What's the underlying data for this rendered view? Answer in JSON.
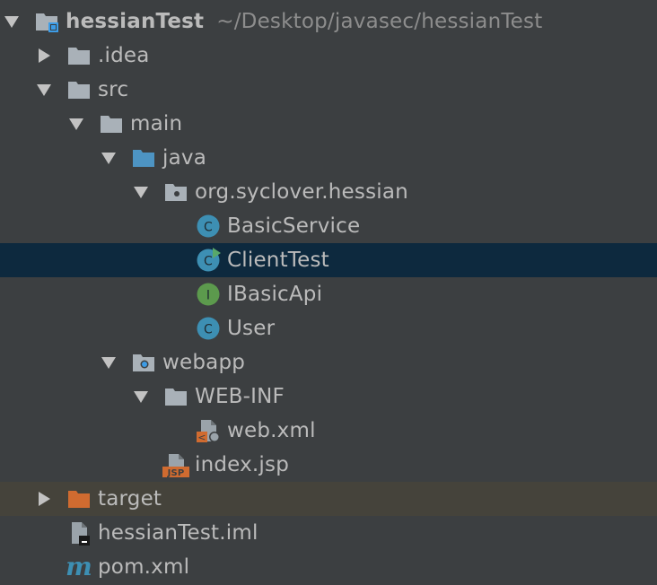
{
  "colors": {
    "background": "#3c3f41",
    "selected_row": "#0d293e",
    "excluded_row": "#45433b",
    "text": "#bbbbbb",
    "path_text": "#8d8d8d",
    "folder": "#a9b1b8",
    "source_folder": "#4d94c3",
    "class_icon": "#3d8fb3",
    "interface_icon": "#5c9a4d",
    "excluded_folder": "#d06b30"
  },
  "tree": [
    {
      "label": "hessianTest",
      "path": "~/Desktop/javasec/hessianTest",
      "icon": "module-folder-icon",
      "arrow": "expanded"
    },
    {
      "label": ".idea",
      "icon": "folder-icon",
      "arrow": "collapsed"
    },
    {
      "label": "src",
      "icon": "folder-icon",
      "arrow": "expanded"
    },
    {
      "label": "main",
      "icon": "folder-icon",
      "arrow": "expanded"
    },
    {
      "label": "java",
      "icon": "source-folder-icon",
      "arrow": "expanded"
    },
    {
      "label": "org.syclover.hessian",
      "icon": "package-icon",
      "arrow": "expanded"
    },
    {
      "label": "BasicService",
      "icon": "class-icon",
      "glyph": "C",
      "arrow": "none"
    },
    {
      "label": "ClientTest",
      "icon": "runnable-class-icon",
      "glyph": "C",
      "arrow": "none",
      "selected": true
    },
    {
      "label": "IBasicApi",
      "icon": "interface-icon",
      "glyph": "I",
      "arrow": "none"
    },
    {
      "label": "User",
      "icon": "class-icon",
      "glyph": "C",
      "arrow": "none"
    },
    {
      "label": "webapp",
      "icon": "web-folder-icon",
      "arrow": "expanded"
    },
    {
      "label": "WEB-INF",
      "icon": "folder-icon",
      "arrow": "expanded"
    },
    {
      "label": "web.xml",
      "icon": "web-xml-icon",
      "arrow": "none"
    },
    {
      "label": "index.jsp",
      "icon": "jsp-file-icon",
      "glyph": "JSP",
      "arrow": "none"
    },
    {
      "label": "target",
      "icon": "excluded-folder-icon",
      "arrow": "collapsed",
      "excluded": true
    },
    {
      "label": "hessianTest.iml",
      "icon": "iml-file-icon",
      "arrow": "none"
    },
    {
      "label": "pom.xml",
      "icon": "maven-file-icon",
      "glyph": "m",
      "arrow": "none"
    }
  ]
}
